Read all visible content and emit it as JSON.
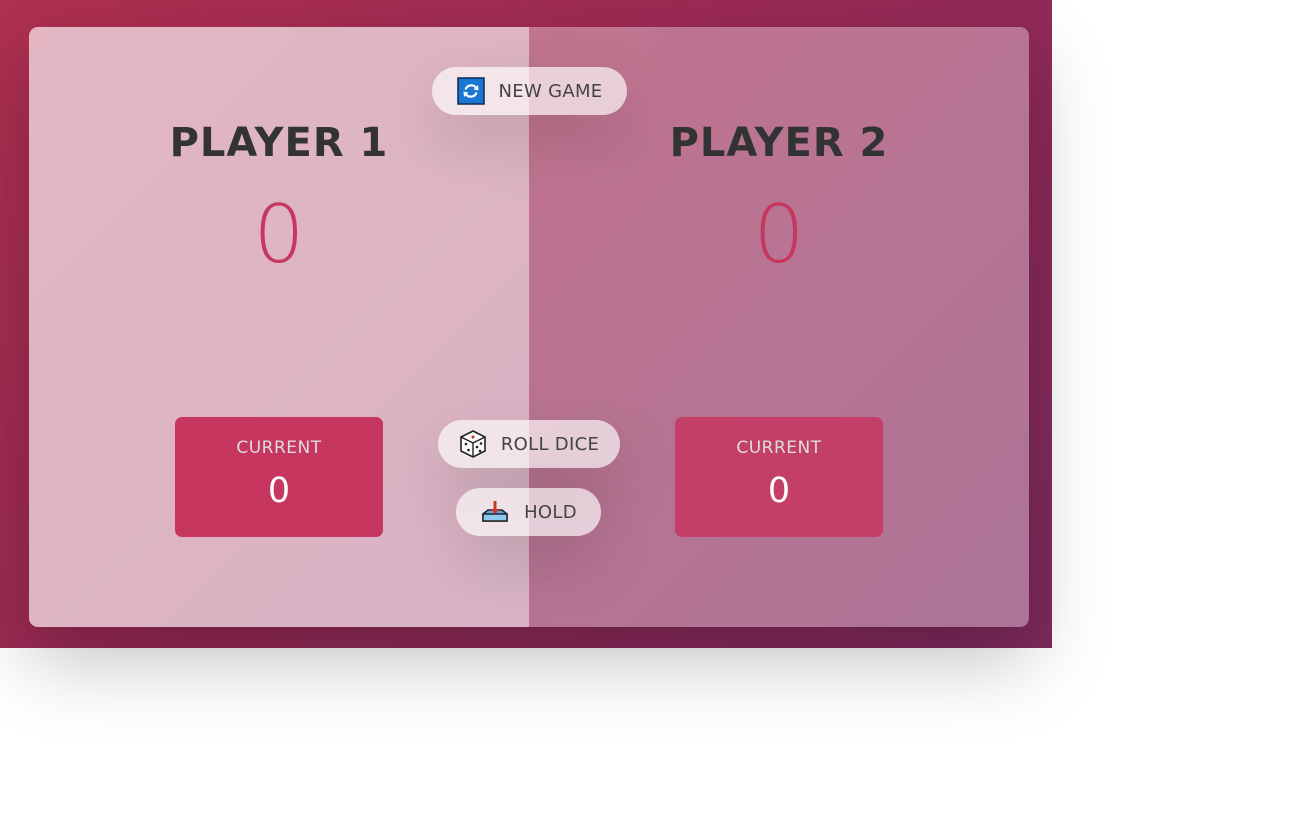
{
  "players": [
    {
      "name": "PLAYER 1",
      "score": "0",
      "current_label": "CURRENT",
      "current_score": "0",
      "active": true
    },
    {
      "name": "PLAYER 2",
      "score": "0",
      "current_label": "CURRENT",
      "current_score": "0",
      "active": false
    }
  ],
  "buttons": {
    "new_game": {
      "label": "NEW GAME",
      "icon": "refresh-icon"
    },
    "roll_dice": {
      "label": "ROLL DICE",
      "icon": "dice-icon"
    },
    "hold": {
      "label": "HOLD",
      "icon": "hold-icon"
    }
  },
  "colors": {
    "accent": "#c7365f",
    "text": "#333333",
    "bg_start": "#b03050",
    "bg_end": "#7e2a5e"
  }
}
